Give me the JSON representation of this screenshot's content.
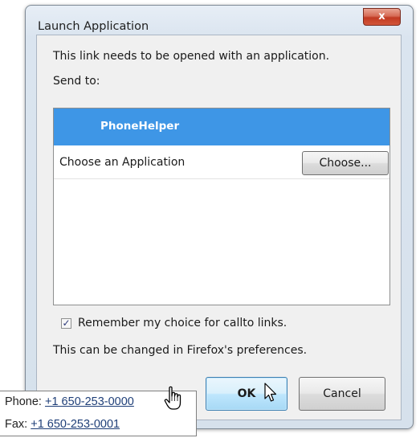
{
  "dialog": {
    "title": "Launch Application",
    "close_label": "x",
    "message": "This link needs to be opened with an application.",
    "send_to_label": "Send to:",
    "apps": {
      "selected": "PhoneHelper",
      "other_label": "Choose an Application",
      "choose_button": "Choose..."
    },
    "remember": {
      "checked": true,
      "check_glyph": "✓",
      "label": "Remember my choice for callto links."
    },
    "note": "This can be changed in Firefox's preferences.",
    "ok_label": "OK",
    "cancel_label": "Cancel"
  },
  "tooltip": {
    "phone_label": "Phone:",
    "phone_number": "+1 650-253-0000",
    "fax_label": "Fax:",
    "fax_number": "+1 650-253-0001"
  },
  "icons": [
    "close-icon",
    "checkbox-check-icon",
    "arrow-cursor-icon",
    "hand-cursor-icon"
  ],
  "colors": {
    "selection": "#3e96e6",
    "close_button": "#c13a22",
    "link": "#1f3f78"
  }
}
